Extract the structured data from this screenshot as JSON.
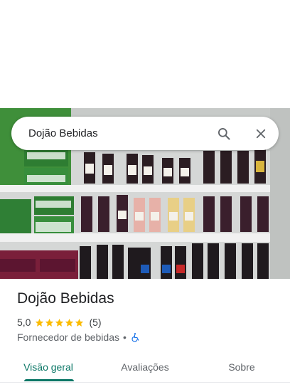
{
  "search": {
    "query": "Dojão Bebidas"
  },
  "place": {
    "name": "Dojão Bebidas",
    "rating": "5,0",
    "stars": 5,
    "review_count": "(5)",
    "category": "Fornecedor de bebidas",
    "separator": "•"
  },
  "tabs": [
    {
      "label": "Visão geral",
      "active": true
    },
    {
      "label": "Avaliações",
      "active": false
    },
    {
      "label": "Sobre",
      "active": false
    }
  ],
  "colors": {
    "accent": "#0b7766",
    "star": "#fbbc04",
    "accessibility": "#1a73e8"
  },
  "icons": {
    "search": "search-icon",
    "close": "close-icon",
    "accessibility": "wheelchair-icon",
    "star": "star-icon"
  }
}
